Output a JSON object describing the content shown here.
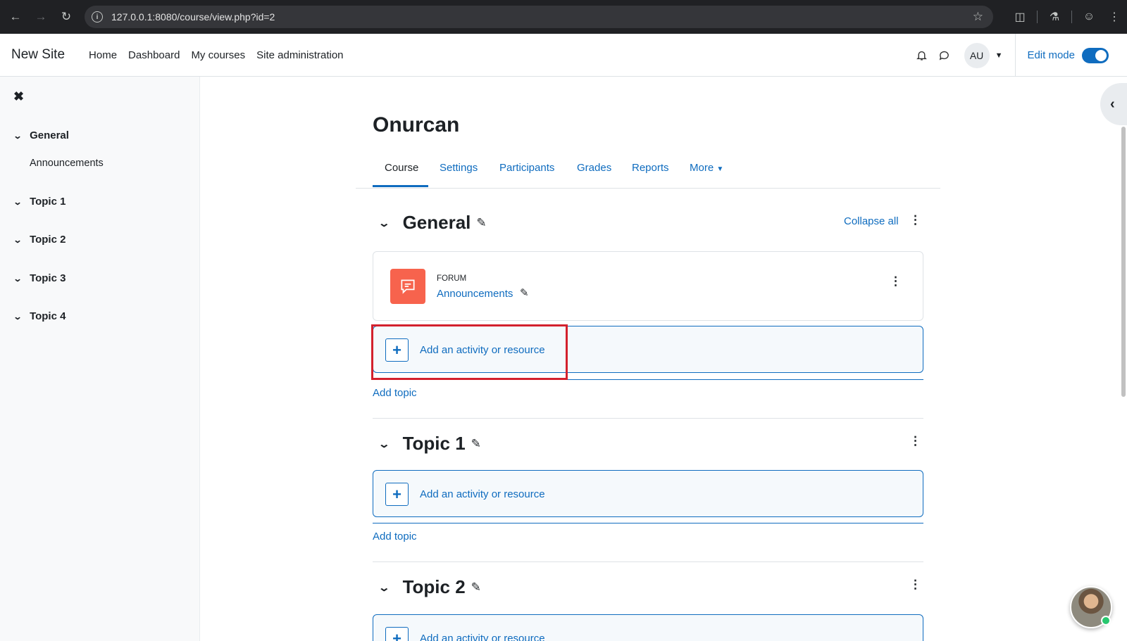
{
  "browser": {
    "url": "127.0.0.1:8080/course/view.php?id=2"
  },
  "navbar": {
    "brand": "New Site",
    "links": [
      "Home",
      "Dashboard",
      "My courses",
      "Site administration"
    ],
    "avatar_initials": "AU",
    "edit_mode_label": "Edit mode",
    "edit_mode_on": true
  },
  "drawer": {
    "sections": [
      {
        "label": "General",
        "items": [
          "Announcements"
        ]
      },
      {
        "label": "Topic 1",
        "items": []
      },
      {
        "label": "Topic 2",
        "items": []
      },
      {
        "label": "Topic 3",
        "items": []
      },
      {
        "label": "Topic 4",
        "items": []
      }
    ]
  },
  "course": {
    "title": "Onurcan",
    "tabs": [
      "Course",
      "Settings",
      "Participants",
      "Grades",
      "Reports",
      "More"
    ],
    "active_tab": "Course",
    "collapse_all_label": "Collapse all",
    "sections": [
      {
        "name": "General",
        "activities": [
          {
            "type": "FORUM",
            "name": "Announcements"
          }
        ],
        "add_activity_label": "Add an activity or resource",
        "add_topic_label": "Add topic"
      },
      {
        "name": "Topic 1",
        "activities": [],
        "add_activity_label": "Add an activity or resource",
        "add_topic_label": "Add topic"
      },
      {
        "name": "Topic 2",
        "activities": [],
        "add_activity_label": "Add an activity or resource"
      }
    ]
  },
  "colors": {
    "accent": "#0f6cbf",
    "forum_icon": "#f7634d",
    "highlight": "#d3212d"
  }
}
